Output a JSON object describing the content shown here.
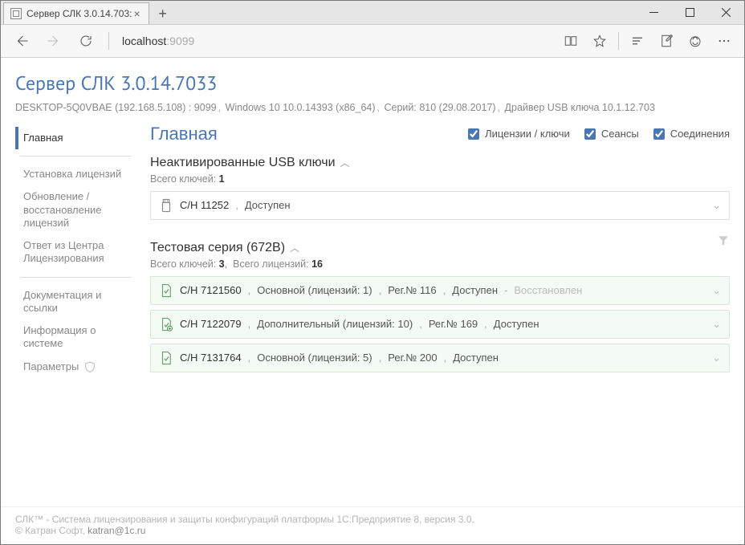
{
  "browser": {
    "tab_title": "Сервер СЛК 3.0.14.703:",
    "address_host": "localhost",
    "address_port": ":9099"
  },
  "header": {
    "title": "Сервер СЛК 3.0.14.7033",
    "host": "DESKTOP-5Q0VBAE (192.168.5.108) : 9099",
    "os": "Windows 10 10.0.14393 (x86_64)",
    "series": "Серий: 810 (29.08.2017)",
    "driver": "Драйвер USB ключа 10.1.12.703"
  },
  "sidebar": {
    "items": [
      "Главная",
      "Установка лицензий",
      "Обновление / восстановление лицензий",
      "Ответ из Центра Лицензирования",
      "Документация и ссылки",
      "Информация о системе",
      "Параметры"
    ]
  },
  "main": {
    "title": "Главная",
    "filters": {
      "licenses": "Лицензии / ключи",
      "sessions": "Сеансы",
      "connections": "Соединения"
    },
    "usb_section": {
      "title": "Неактивированные USB ключи",
      "total_label": "Всего ключей:",
      "total_value": "1",
      "items": [
        {
          "sn_label": "С/Н 11252",
          "status": "Доступен"
        }
      ]
    },
    "test_section": {
      "title": "Тестовая серия (672B)",
      "total_keys_label": "Всего ключей:",
      "total_keys_value": "3",
      "total_lic_label": "Всего лицензий:",
      "total_lic_value": "16",
      "items": [
        {
          "sn": "С/Н 7121560",
          "type": "Основной (лицензий: 1)",
          "reg": "Рег.№ 116",
          "status": "Доступен",
          "restored": "Восстановлен"
        },
        {
          "sn": "С/Н 7122079",
          "type": "Дополнительный (лицензий: 10)",
          "reg": "Рег.№ 169",
          "status": "Доступен",
          "restored": ""
        },
        {
          "sn": "С/Н 7131764",
          "type": "Основной (лицензий: 5)",
          "reg": "Рег.№ 200",
          "status": "Доступен",
          "restored": ""
        }
      ]
    }
  },
  "footer": {
    "line1": "СЛК™ - Система лицензирования и защиты конфигураций платформы 1С:Предприятие 8, версия 3.0.",
    "line2_prefix": "© Катран Софт, ",
    "email": "katran@1c.ru"
  }
}
